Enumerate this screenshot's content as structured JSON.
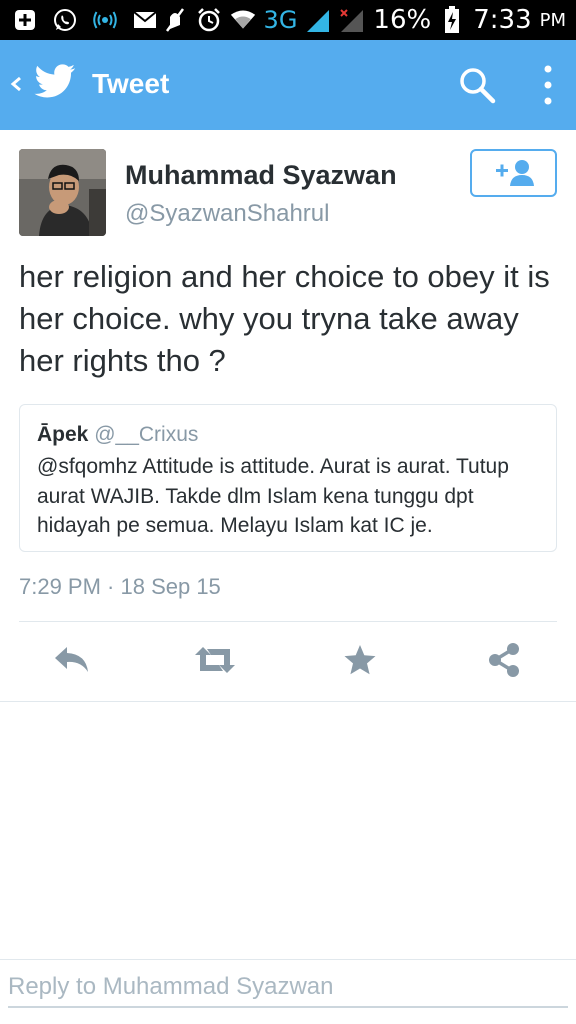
{
  "status_bar": {
    "network": "3G",
    "battery": "16%",
    "time": "7:33",
    "ampm": "PM"
  },
  "app_bar": {
    "title": "Tweet"
  },
  "tweet": {
    "author_name": "Muhammad Syazwan",
    "author_handle": "@SyazwanShahrul",
    "text": "her religion and her choice to obey it is her choice. why you tryna take away her rights tho ?",
    "timestamp": "7:29 PM · 18 Sep 15"
  },
  "quoted_tweet": {
    "author_name": "Āpek",
    "author_handle": "@__Crixus",
    "text": "@sfqomhz Attitude is attitude. Aurat is aurat. Tutup aurat WAJIB. Takde dlm Islam kena tunggu dpt hidayah pe semua. Melayu Islam kat IC je."
  },
  "reply": {
    "placeholder": "Reply to Muhammad Syazwan"
  },
  "colors": {
    "brand": "#55acee",
    "icon_gray": "#8899a6",
    "text": "#292f33"
  },
  "icons": [
    "back-icon",
    "twitter-bird-icon",
    "search-icon",
    "more-icon",
    "follow-icon",
    "reply-icon",
    "retweet-icon",
    "favorite-icon",
    "share-icon"
  ]
}
